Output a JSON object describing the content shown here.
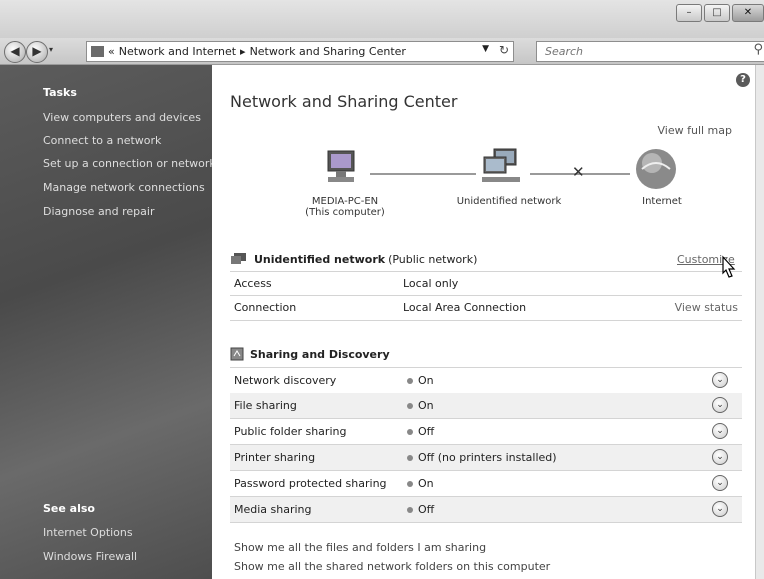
{
  "window": {
    "address_prefix": "«",
    "breadcrumb_1": "Network and Internet",
    "breadcrumb_sep": "▸",
    "breadcrumb_2": "Network and Sharing Center",
    "search_placeholder": "Search"
  },
  "sidebar": {
    "tasks_heading": "Tasks",
    "tasks": [
      "View computers and devices",
      "Connect to a network",
      "Set up a connection or network",
      "Manage network connections",
      "Diagnose and repair"
    ],
    "see_also_heading": "See also",
    "see_also": [
      "Internet Options",
      "Windows Firewall"
    ]
  },
  "main": {
    "title": "Network and Sharing Center",
    "view_full_map": "View full map",
    "map": {
      "computer_name": "MEDIA-PC-EN",
      "computer_sub": "(This computer)",
      "network_name": "Unidentified network",
      "internet": "Internet"
    },
    "network": {
      "name": "Unidentified network",
      "type": "(Public network)",
      "customize": "Customize",
      "rows": [
        {
          "label": "Access",
          "value": "Local only",
          "action": ""
        },
        {
          "label": "Connection",
          "value": "Local Area Connection",
          "action": "View status"
        }
      ]
    },
    "sharing": {
      "heading": "Sharing and Discovery",
      "rows": [
        {
          "label": "Network discovery",
          "status": "On"
        },
        {
          "label": "File sharing",
          "status": "On"
        },
        {
          "label": "Public folder sharing",
          "status": "Off"
        },
        {
          "label": "Printer sharing",
          "status": "Off (no printers installed)"
        },
        {
          "label": "Password protected sharing",
          "status": "On"
        },
        {
          "label": "Media sharing",
          "status": "Off"
        }
      ]
    },
    "footer_links": [
      "Show me all the files and folders I am sharing",
      "Show me all the shared network folders on this computer"
    ]
  }
}
